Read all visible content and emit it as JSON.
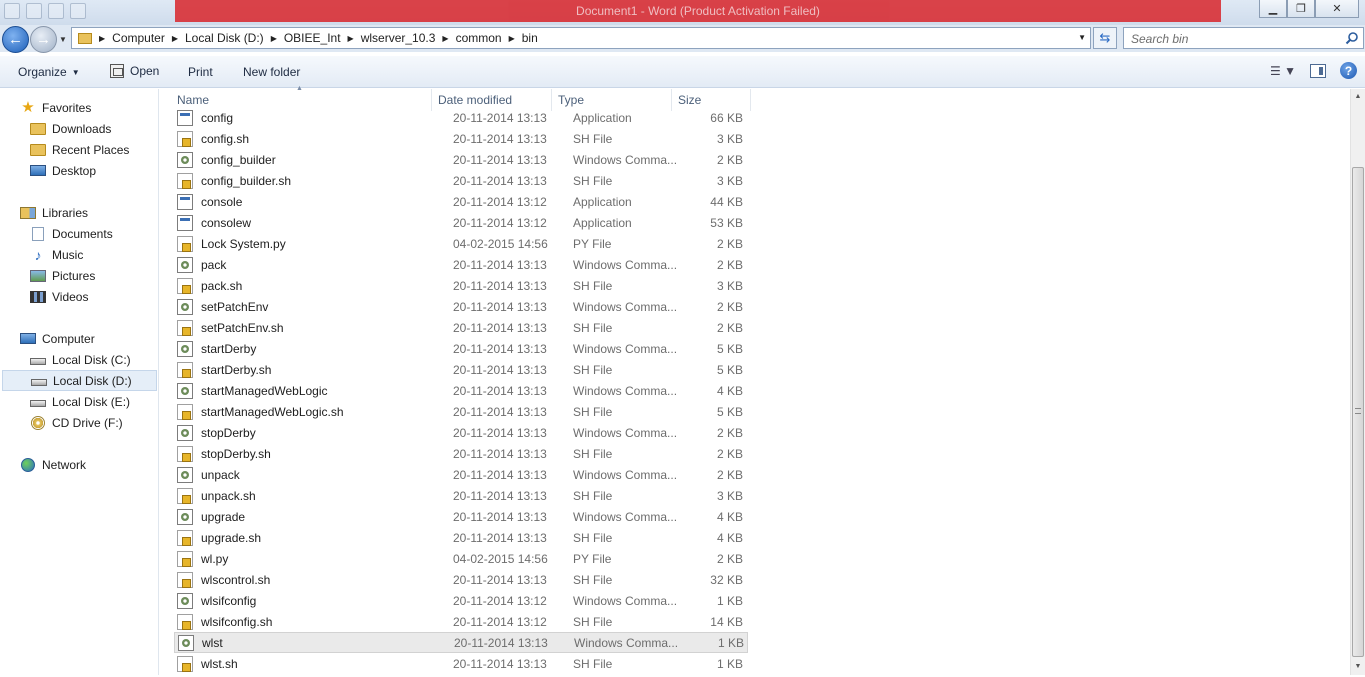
{
  "window": {
    "banner_text": "Document1 - Word (Product Activation Failed)"
  },
  "address": {
    "breadcrumbs": [
      "Computer",
      "Local Disk (D:)",
      "OBIEE_Int",
      "wlserver_10.3",
      "common",
      "bin"
    ]
  },
  "search": {
    "placeholder": "Search bin"
  },
  "toolbar": {
    "organize": "Organize",
    "open": "Open",
    "print": "Print",
    "new_folder": "New folder"
  },
  "navpane": {
    "favorites": "Favorites",
    "downloads": "Downloads",
    "recent_places": "Recent Places",
    "desktop": "Desktop",
    "libraries": "Libraries",
    "documents": "Documents",
    "music": "Music",
    "pictures": "Pictures",
    "videos": "Videos",
    "computer": "Computer",
    "drive_c": "Local Disk (C:)",
    "drive_d": "Local Disk (D:)",
    "drive_e": "Local Disk (E:)",
    "drive_f": "CD Drive (F:)",
    "network": "Network"
  },
  "columns": {
    "name": "Name",
    "date": "Date modified",
    "type": "Type",
    "size": "Size"
  },
  "files": [
    {
      "name": "config",
      "date": "20-11-2014 13:13",
      "type": "Application",
      "size": "66 KB",
      "icon": "app"
    },
    {
      "name": "config.sh",
      "date": "20-11-2014 13:13",
      "type": "SH File",
      "size": "3 KB",
      "icon": "sh"
    },
    {
      "name": "config_builder",
      "date": "20-11-2014 13:13",
      "type": "Windows Comma...",
      "size": "2 KB",
      "icon": "cmd"
    },
    {
      "name": "config_builder.sh",
      "date": "20-11-2014 13:13",
      "type": "SH File",
      "size": "3 KB",
      "icon": "sh"
    },
    {
      "name": "console",
      "date": "20-11-2014 13:12",
      "type": "Application",
      "size": "44 KB",
      "icon": "app"
    },
    {
      "name": "consolew",
      "date": "20-11-2014 13:12",
      "type": "Application",
      "size": "53 KB",
      "icon": "app"
    },
    {
      "name": "Lock System.py",
      "date": "04-02-2015 14:56",
      "type": "PY File",
      "size": "2 KB",
      "icon": "sh"
    },
    {
      "name": "pack",
      "date": "20-11-2014 13:13",
      "type": "Windows Comma...",
      "size": "2 KB",
      "icon": "cmd"
    },
    {
      "name": "pack.sh",
      "date": "20-11-2014 13:13",
      "type": "SH File",
      "size": "3 KB",
      "icon": "sh"
    },
    {
      "name": "setPatchEnv",
      "date": "20-11-2014 13:13",
      "type": "Windows Comma...",
      "size": "2 KB",
      "icon": "cmd"
    },
    {
      "name": "setPatchEnv.sh",
      "date": "20-11-2014 13:13",
      "type": "SH File",
      "size": "2 KB",
      "icon": "sh"
    },
    {
      "name": "startDerby",
      "date": "20-11-2014 13:13",
      "type": "Windows Comma...",
      "size": "5 KB",
      "icon": "cmd"
    },
    {
      "name": "startDerby.sh",
      "date": "20-11-2014 13:13",
      "type": "SH File",
      "size": "5 KB",
      "icon": "sh"
    },
    {
      "name": "startManagedWebLogic",
      "date": "20-11-2014 13:13",
      "type": "Windows Comma...",
      "size": "4 KB",
      "icon": "cmd"
    },
    {
      "name": "startManagedWebLogic.sh",
      "date": "20-11-2014 13:13",
      "type": "SH File",
      "size": "5 KB",
      "icon": "sh"
    },
    {
      "name": "stopDerby",
      "date": "20-11-2014 13:13",
      "type": "Windows Comma...",
      "size": "2 KB",
      "icon": "cmd"
    },
    {
      "name": "stopDerby.sh",
      "date": "20-11-2014 13:13",
      "type": "SH File",
      "size": "2 KB",
      "icon": "sh"
    },
    {
      "name": "unpack",
      "date": "20-11-2014 13:13",
      "type": "Windows Comma...",
      "size": "2 KB",
      "icon": "cmd"
    },
    {
      "name": "unpack.sh",
      "date": "20-11-2014 13:13",
      "type": "SH File",
      "size": "3 KB",
      "icon": "sh"
    },
    {
      "name": "upgrade",
      "date": "20-11-2014 13:13",
      "type": "Windows Comma...",
      "size": "4 KB",
      "icon": "cmd"
    },
    {
      "name": "upgrade.sh",
      "date": "20-11-2014 13:13",
      "type": "SH File",
      "size": "4 KB",
      "icon": "sh"
    },
    {
      "name": "wl.py",
      "date": "04-02-2015 14:56",
      "type": "PY File",
      "size": "2 KB",
      "icon": "sh"
    },
    {
      "name": "wlscontrol.sh",
      "date": "20-11-2014 13:13",
      "type": "SH File",
      "size": "32 KB",
      "icon": "sh"
    },
    {
      "name": "wlsifconfig",
      "date": "20-11-2014 13:12",
      "type": "Windows Comma...",
      "size": "1 KB",
      "icon": "cmd"
    },
    {
      "name": "wlsifconfig.sh",
      "date": "20-11-2014 13:12",
      "type": "SH File",
      "size": "14 KB",
      "icon": "sh"
    },
    {
      "name": "wlst",
      "date": "20-11-2014 13:13",
      "type": "Windows Comma...",
      "size": "1 KB",
      "icon": "cmd",
      "selected": true
    },
    {
      "name": "wlst.sh",
      "date": "20-11-2014 13:13",
      "type": "SH File",
      "size": "1 KB",
      "icon": "sh"
    }
  ]
}
